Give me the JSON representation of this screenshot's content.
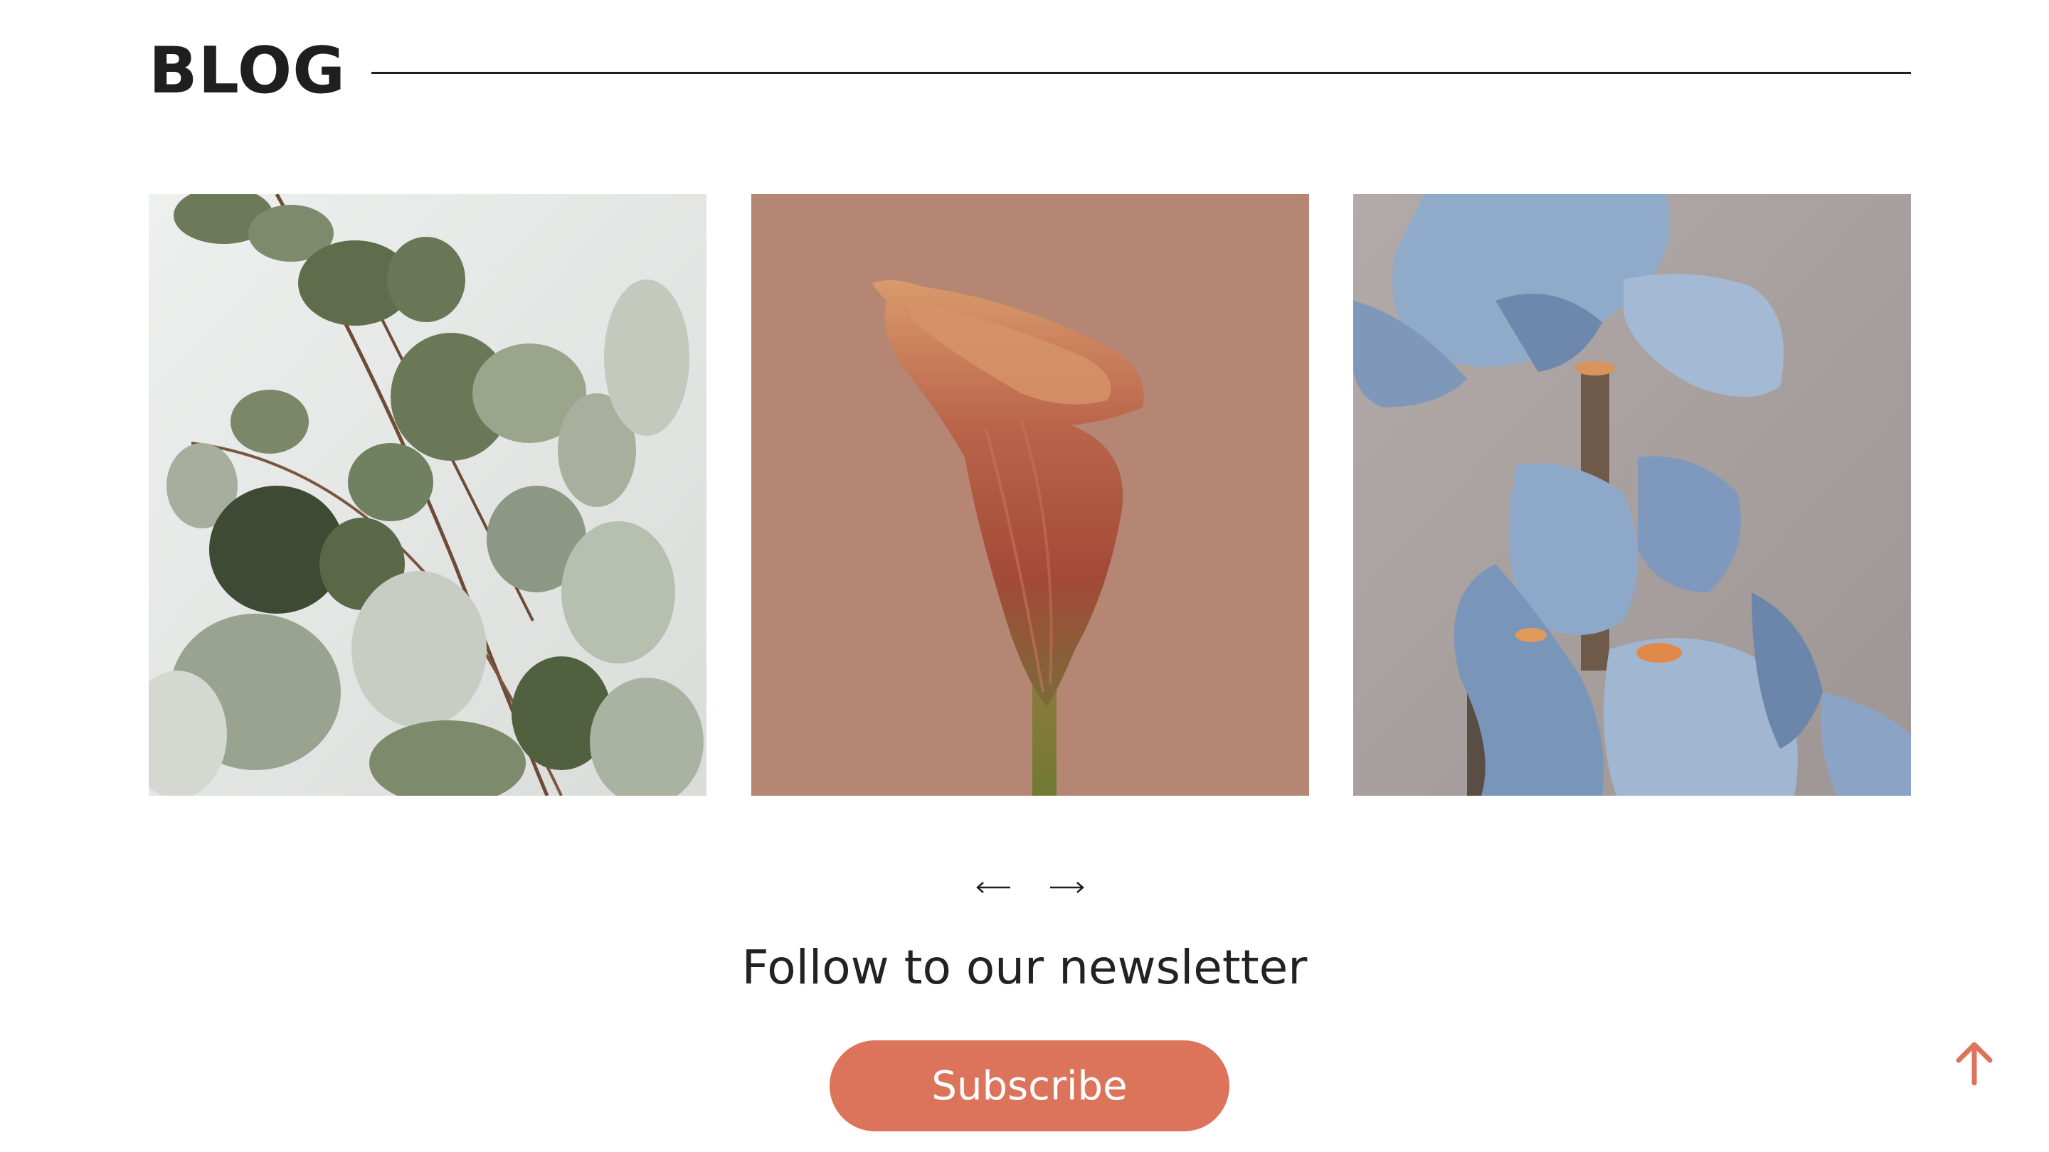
{
  "header": {
    "title": "BLOG"
  },
  "blog_cards": [
    {
      "image": "eucalyptus-leaves-photo"
    },
    {
      "image": "calla-lily-photo"
    },
    {
      "image": "blue-iris-photo"
    }
  ],
  "pager": {
    "prev_icon": "arrow-left-icon",
    "next_icon": "arrow-right-icon"
  },
  "newsletter": {
    "heading": "Follow to our newsletter",
    "button_label": "Subscribe"
  },
  "scroll_top": {
    "icon": "arrow-up-icon"
  },
  "colors": {
    "accent": "#dc745b",
    "text": "#1f1f1f",
    "background": "#ffffff"
  }
}
